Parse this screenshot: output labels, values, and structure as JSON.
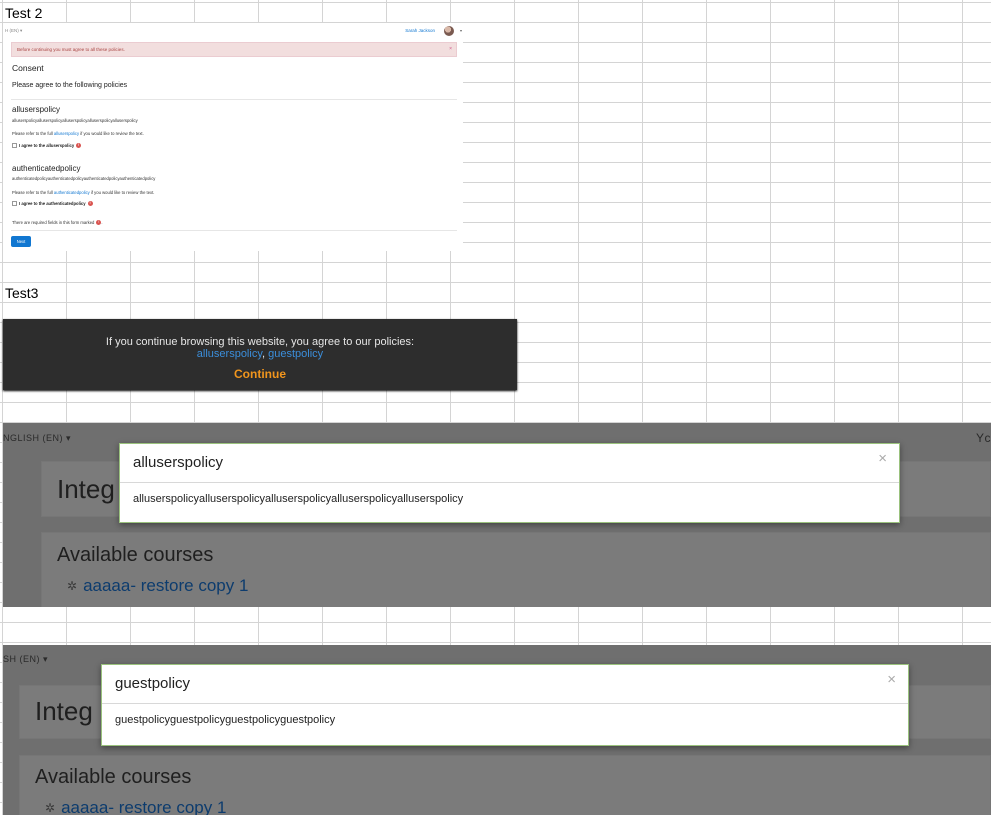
{
  "labels": {
    "test2": "Test 2",
    "test3": "Test3"
  },
  "test2": {
    "language": "H (EN) ▾",
    "user_name": "Sarah Jackson",
    "alert": "Before continuing you must agree to all these policies.",
    "alert_close": "×",
    "heading": "Consent",
    "subheading": "Please agree to the following policies",
    "policies": [
      {
        "name": "alluserspolicy",
        "text": "alluserspolicyalluserspolicyalluserspolicyalluserspolicyalluserspolicy",
        "refer_prefix": "Please refer to the full ",
        "refer_link": "alluserspolicy",
        "refer_suffix": " if you would like to review the text.",
        "agree_label": "I agree to the alluserspolicy"
      },
      {
        "name": "authenticatedpolicy",
        "text": "authenticatedpolicyauthenticatedpolicyauthenticatedpolicyauthenticatedpolicy",
        "refer_prefix": "Please refer to the full ",
        "refer_link": "authenticatedpolicy",
        "refer_suffix": " if you would like to review the text.",
        "agree_label": "I agree to the authenticatedpolicy"
      }
    ],
    "required_note": "There are required fields in this form marked",
    "required_note_end": ".",
    "next_label": "Next"
  },
  "test3": {
    "message": "If you continue browsing this website, you agree to our policies:",
    "link1": "alluserspolicy",
    "separator": ", ",
    "link2": "guestpolicy",
    "continue_label": "Continue"
  },
  "shot3": {
    "language": "NGLISH (EN) ▾",
    "right_cut": "Yc",
    "card_title": "Integ",
    "available": "Available courses",
    "course": "aaaaa- restore copy 1",
    "modal_title": "alluserspolicy",
    "modal_close": "×",
    "modal_body": "alluserspolicyalluserspolicyalluserspolicyalluserspolicyalluserspolicy"
  },
  "shot4": {
    "language": "SH (EN) ▾",
    "card_title": "Integ",
    "available": "Available courses",
    "course": "aaaaa- restore copy 1",
    "modal_title": "guestpolicy",
    "modal_close": "×",
    "modal_body": "guestpolicyguestpolicyguestpolicyguestpolicy"
  },
  "colors": {
    "link": "#1177d1",
    "alert_bg": "#f2dede",
    "banner_bg": "#2d2d2d",
    "continue": "#f0951d",
    "overlay": "#6f6f6f"
  }
}
